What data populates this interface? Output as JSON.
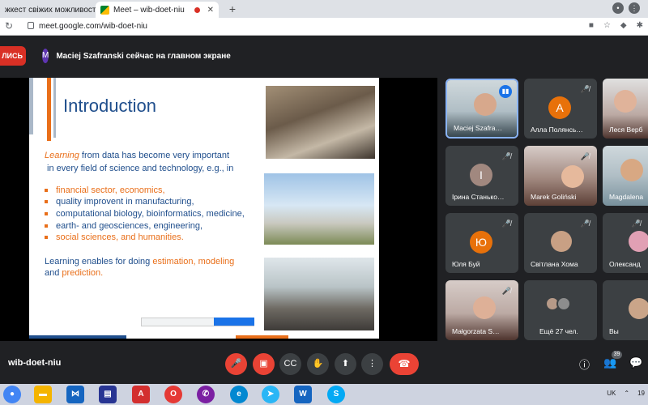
{
  "browser": {
    "tabs": [
      {
        "title": "жкест свіжих можливостей",
        "active": false
      },
      {
        "title": "Meet – wib-doet-niu",
        "active": true
      }
    ],
    "url": "meet.google.com/wib-doet-niu"
  },
  "meet": {
    "record_label": "ЛИСЬ",
    "presenter_initial": "M",
    "presenter_notice": "Maciej Szafranski сейчас на главном экране",
    "meeting_code": "wib-doet-niu",
    "participants_count": "39"
  },
  "slide": {
    "title": "Introduction",
    "line1_em": "Learning",
    "line1_rest": " from data has become very important",
    "line2": "in every field of science and technology, e.g., in",
    "bullets": [
      {
        "text": "financial sector, economics,",
        "color": "orange"
      },
      {
        "text": "quality improvent in manufacturing,",
        "color": "blue"
      },
      {
        "text": "computational biology, bioinformatics, medicine,",
        "color": "blue"
      },
      {
        "text": "earth- and geosciences, engineering,",
        "color": "blue"
      },
      {
        "text": "social sciences, and humanities.",
        "color": "orange"
      }
    ],
    "line3_pre": "Learning enables for doing ",
    "line3_orange": "estimation, modeling",
    "line4_pre": "and ",
    "line4_orange": "prediction."
  },
  "participants": [
    {
      "name": "Maciej Szafra…",
      "type": "photo",
      "speaking": true
    },
    {
      "name": "Алла Полянсь…",
      "type": "initial",
      "initial": "А",
      "color": "#e8710a"
    },
    {
      "name": "Леся Верб",
      "type": "photo"
    },
    {
      "name": "Ірина Станько…",
      "type": "initial",
      "initial": "І",
      "color": "#a1887f"
    },
    {
      "name": "Marek Goliński",
      "type": "photo"
    },
    {
      "name": "Magdalena",
      "type": "photo"
    },
    {
      "name": "Юля Буй",
      "type": "initial",
      "initial": "Ю",
      "color": "#e8710a"
    },
    {
      "name": "Світлана Хома",
      "type": "avatar"
    },
    {
      "name": "Олександ",
      "type": "avatar"
    },
    {
      "name": "Małgorzata S…",
      "type": "photo"
    },
    {
      "name": "Ещё 27 чел.",
      "type": "more"
    },
    {
      "name": "Вы",
      "type": "avatar"
    }
  ],
  "taskbar": {
    "lang": "UK",
    "time": "19"
  },
  "colors": {
    "accent_blue": "#1f4e8c",
    "accent_orange": "#e96f1a",
    "meet_red": "#ea4335",
    "meet_bg": "#202124"
  }
}
